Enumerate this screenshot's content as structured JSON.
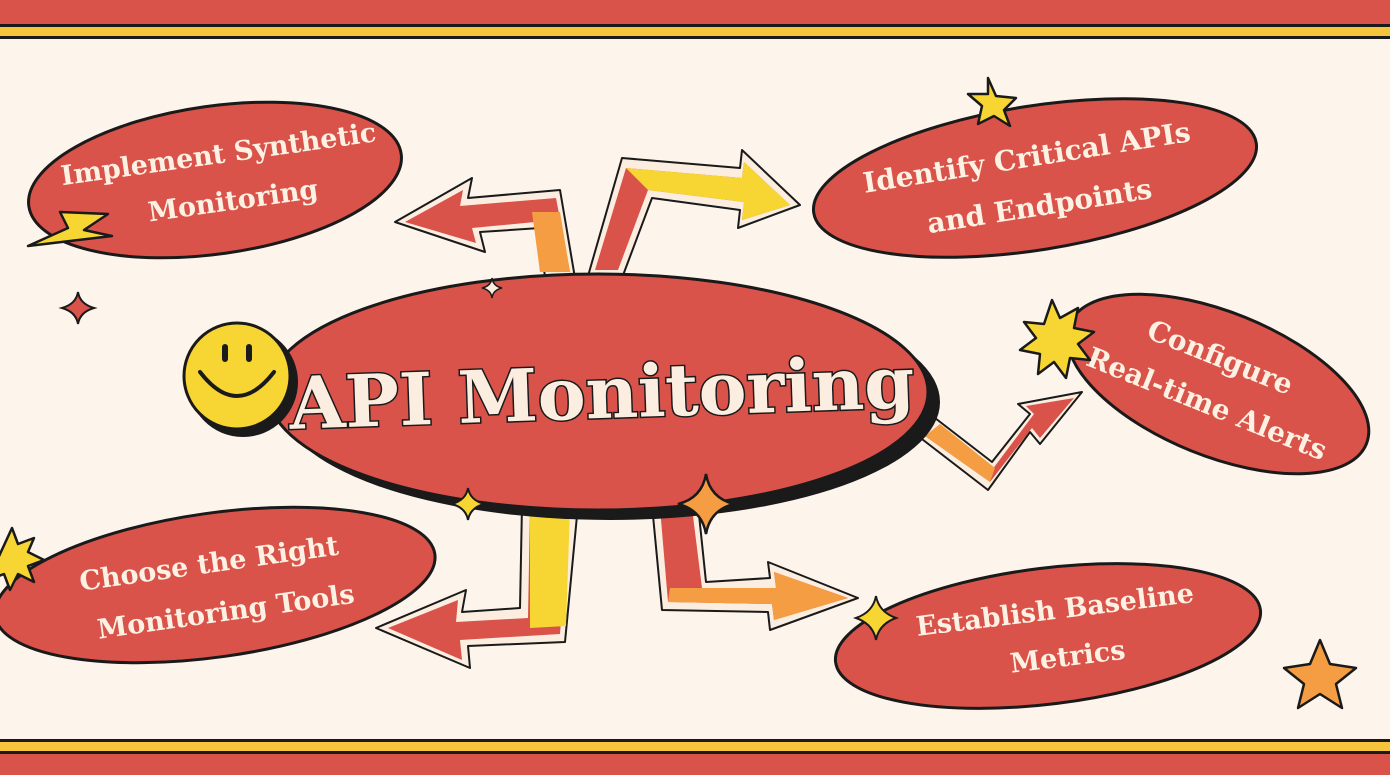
{
  "diagram": {
    "title": "API Monitoring",
    "nodes": [
      {
        "id": "synthetic",
        "lines": [
          "Implement Synthetic",
          "Monitoring"
        ]
      },
      {
        "id": "critical",
        "lines": [
          "Identify Critical APIs",
          "and Endpoints"
        ]
      },
      {
        "id": "alerts",
        "lines": [
          "Configure",
          "Real-time Alerts"
        ]
      },
      {
        "id": "baseline",
        "lines": [
          "Establish Baseline",
          "Metrics"
        ]
      },
      {
        "id": "tools",
        "lines": [
          "Choose the Right",
          "Monitoring Tools"
        ]
      }
    ]
  },
  "colors": {
    "background": "#fdf5ec",
    "red": "#d9534a",
    "yellow": "#f7d633",
    "orange": "#f59d42",
    "outline": "#1a1a1a",
    "text": "#fdf1e3"
  },
  "icons": [
    "smiley-icon",
    "sparkle-icon",
    "star-icon",
    "burst-icon",
    "lightning-icon"
  ]
}
